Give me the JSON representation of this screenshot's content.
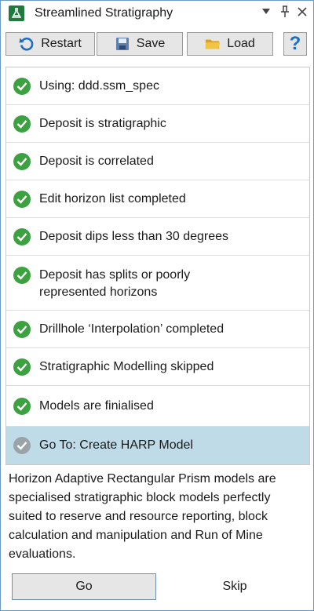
{
  "window": {
    "title": "Streamlined Stratigraphy",
    "controls": {
      "dropdown_glyph": "▼",
      "pin_glyph": "📌",
      "close_glyph": "✕"
    }
  },
  "toolbar": {
    "restart_label": "Restart",
    "save_label": "Save",
    "load_label": "Load",
    "help_label": "?"
  },
  "steps": [
    {
      "label": "Using: ddd.ssm_spec",
      "status": "complete"
    },
    {
      "label": "Deposit is stratigraphic",
      "status": "complete"
    },
    {
      "label": "Deposit is correlated",
      "status": "complete"
    },
    {
      "label": "Edit horizon list completed",
      "status": "complete"
    },
    {
      "label": "Deposit dips less than 30 degrees",
      "status": "complete"
    },
    {
      "label": "Deposit has splits or poorly",
      "label_line2": "represented horizons",
      "status": "complete"
    },
    {
      "label": "Drillhole ‘Interpolation’ completed",
      "status": "complete"
    },
    {
      "label": "Stratigraphic Modelling skipped",
      "status": "complete"
    },
    {
      "label": "Models are finialised",
      "status": "complete"
    },
    {
      "label": "Go To: Create HARP Model",
      "status": "current"
    }
  ],
  "description": {
    "lines": [
      "Horizon Adaptive Rectangular Prism models are",
      "specialised stratigraphic block models perfectly",
      "suited to reserve and resource reporting, block",
      "calculation and manipulation and Run of Mine",
      "evaluations."
    ]
  },
  "actions": {
    "go_label": "Go",
    "skip_label": "Skip"
  },
  "colors": {
    "check_complete": "#3ba23f",
    "check_current": "#9aa3a8",
    "current_row_bg": "#bfdbe7",
    "help_blue": "#1a6fc1",
    "border": "#6b9bc3"
  }
}
